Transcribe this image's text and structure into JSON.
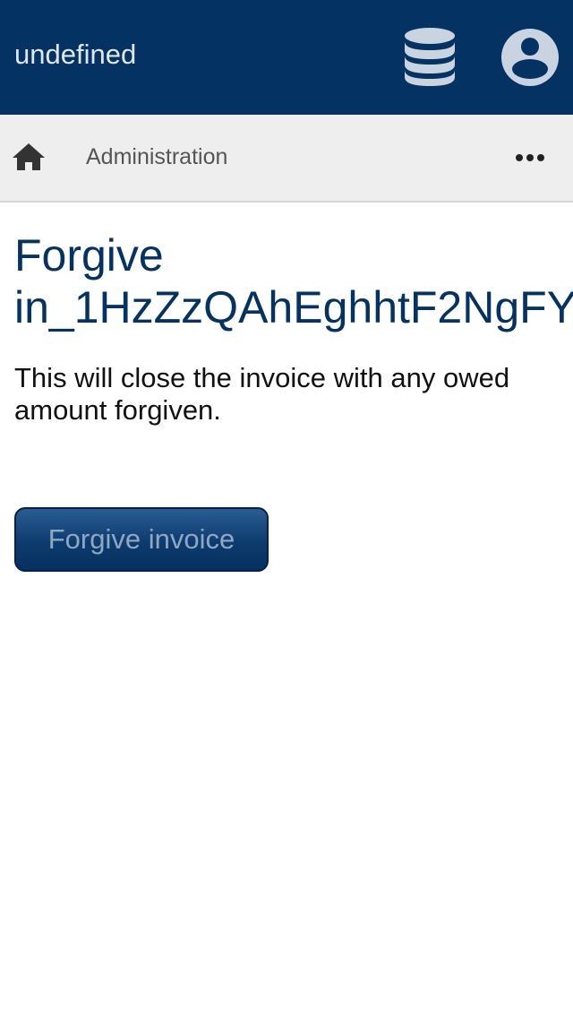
{
  "header": {
    "app_title": "undefined",
    "icons": [
      "database-icon",
      "account-circle-icon"
    ],
    "background_color": "#033263"
  },
  "navbar": {
    "home_icon": "home-icon",
    "section_label": "Administration",
    "more_icon": "more-horizontal-icon"
  },
  "main": {
    "title_line1": "Forgive",
    "title_line2": "in_1HzZzQAhEghhtF2NgFY",
    "description": "This will close the invoice with any owed amount forgiven.",
    "forgive_button_label": "Forgive invoice"
  },
  "colors": {
    "brand": "#033263",
    "nav_background": "#eeeeee"
  }
}
